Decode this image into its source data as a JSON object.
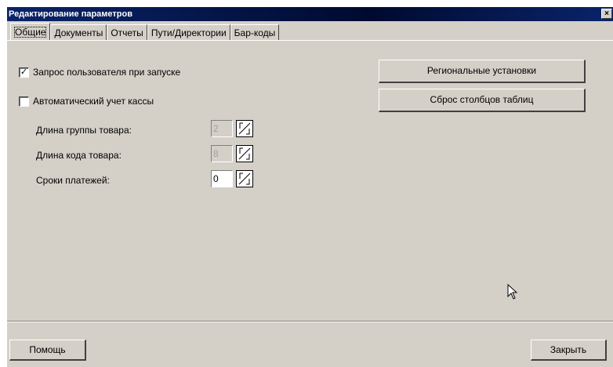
{
  "window": {
    "title": "Редактирование параметров",
    "close_glyph": "×"
  },
  "tabs": [
    {
      "label": "Общие"
    },
    {
      "label": "Документы"
    },
    {
      "label": "Отчеты"
    },
    {
      "label": "Пути/Директории"
    },
    {
      "label": "Бар-коды"
    }
  ],
  "general": {
    "prompt_user_on_startup": {
      "label": "Запрос пользователя при запуске",
      "checked": true
    },
    "auto_cash_accounting": {
      "label": "Автоматический учет кассы",
      "checked": false
    },
    "fields": [
      {
        "label": "Длина группы товара:",
        "value": "2",
        "enabled": false
      },
      {
        "label": "Длина кода товара:",
        "value": "8",
        "enabled": false
      },
      {
        "label": "Сроки платежей:",
        "value": "0",
        "enabled": true
      }
    ],
    "regional_settings_button": "Региональные установки",
    "reset_columns_button": "Сброс столбцов таблиц"
  },
  "footer": {
    "help_button": "Помощь",
    "close_button": "Закрыть"
  },
  "icons": {
    "checkbox_check": "checkmark-icon",
    "spin": "spin-arrows-icon",
    "cursor": "mouse-pointer-icon"
  }
}
